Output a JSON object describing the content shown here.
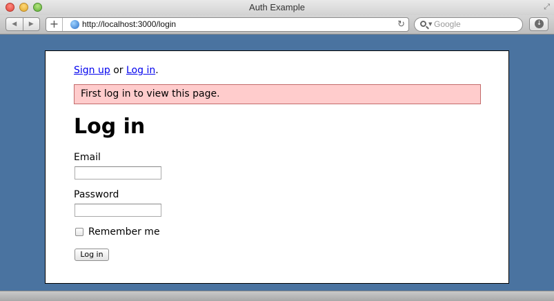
{
  "window": {
    "title": "Auth Example"
  },
  "toolbar": {
    "url": "http://localhost:3000/login",
    "search_placeholder": "Google"
  },
  "page": {
    "nav": {
      "signup_label": "Sign up",
      "separator": " or ",
      "login_label": "Log in",
      "end_punct": "."
    },
    "flash_message": "First log in to view this page.",
    "title": "Log in",
    "form": {
      "email_label": "Email",
      "email_value": "",
      "password_label": "Password",
      "password_value": "",
      "remember_label": "Remember me",
      "remember_checked": false,
      "submit_label": "Log in"
    }
  },
  "colors": {
    "page_background": "#4a73a0",
    "flash_background": "#ffcccc",
    "flash_border": "#c26a6a",
    "link": "#0000ee"
  }
}
